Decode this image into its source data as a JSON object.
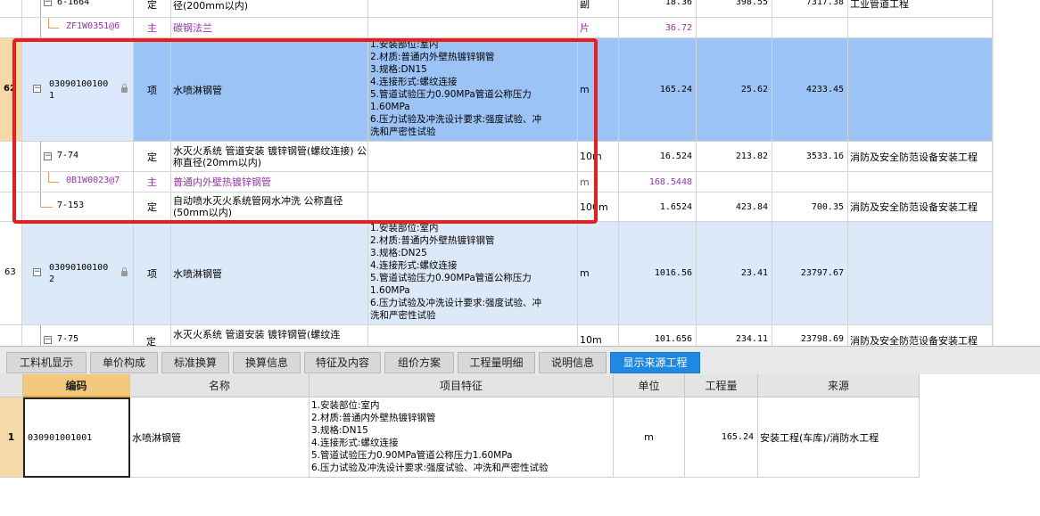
{
  "upper_grid": {
    "rows": [
      {
        "idx": "",
        "code": "6-1664",
        "type": "定",
        "name": "径(200mm以内)",
        "features": [],
        "unit": "副",
        "qty": "18.36",
        "price": "398.55",
        "total": "7317.38",
        "profession": "工业管道工程"
      },
      {
        "idx": "",
        "code": "ZF1W0351@6",
        "type": "主",
        "name": "碳钢法兰",
        "features": [],
        "unit": "片",
        "qty": "36.72",
        "price": "",
        "total": "",
        "profession": ""
      },
      {
        "idx": "62",
        "code": "030901001001",
        "type": "项",
        "name": "水喷淋钢管",
        "features": [
          "1.安装部位:室内",
          "2.材质:普通内外壁热镀锌钢管",
          "3.规格:DN15",
          "4.连接形式:螺纹连接",
          "5.管道试验压力0.90MPa管道公称压力",
          "1.60MPa",
          "6.压力试验及冲洗设计要求:强度试验、冲",
          "洗和严密性试验"
        ],
        "unit": "m",
        "qty": "165.24",
        "price": "25.62",
        "total": "4233.45",
        "profession": ""
      },
      {
        "idx": "",
        "code": "7-74",
        "type": "定",
        "name": "水灭火系统 管道安装 镀锌钢管(螺纹连接) 公称直径(20mm以内)",
        "features": [],
        "unit": "10m",
        "qty": "16.524",
        "price": "213.82",
        "total": "3533.16",
        "profession": "消防及安全防范设备安装工程"
      },
      {
        "idx": "",
        "code": "0B1W0023@7",
        "type": "主",
        "name": "普通内外壁热镀锌钢管",
        "features": [],
        "unit": "m",
        "qty": "168.5448",
        "price": "",
        "total": "",
        "profession": ""
      },
      {
        "idx": "",
        "code": "7-153",
        "type": "定",
        "name": "自动喷水灭火系统管网水冲洗 公称直径(50mm以内)",
        "features": [],
        "unit": "100m",
        "qty": "1.6524",
        "price": "423.84",
        "total": "700.35",
        "profession": "消防及安全防范设备安装工程"
      },
      {
        "idx": "63",
        "code": "030901001002",
        "type": "项",
        "name": "水喷淋钢管",
        "features": [
          "1.安装部位:室内",
          "2.材质:普通内外壁热镀锌钢管",
          "3.规格:DN25",
          "4.连接形式:螺纹连接",
          "5.管道试验压力0.90MPa管道公称压力",
          "1.60MPa",
          "6.压力试验及冲洗设计要求:强度试验、冲",
          "洗和严密性试验"
        ],
        "unit": "m",
        "qty": "1016.56",
        "price": "23.41",
        "total": "23797.67",
        "profession": ""
      },
      {
        "idx": "",
        "code": "7-75",
        "type": "定",
        "name": "水灭火系统 管道安装 镀锌钢管(螺纹连",
        "features": [],
        "unit": "10m",
        "qty": "101.656",
        "price": "234.11",
        "total": "23798.69",
        "profession": "消防及安全防范设备安装工程"
      }
    ]
  },
  "tabs": [
    {
      "label": "工料机显示",
      "active": false
    },
    {
      "label": "单价构成",
      "active": false
    },
    {
      "label": "标准换算",
      "active": false
    },
    {
      "label": "换算信息",
      "active": false
    },
    {
      "label": "特征及内容",
      "active": false
    },
    {
      "label": "组价方案",
      "active": false
    },
    {
      "label": "工程量明细",
      "active": false
    },
    {
      "label": "说明信息",
      "active": false
    },
    {
      "label": "显示来源工程",
      "active": true
    }
  ],
  "source_table": {
    "headers": [
      "编码",
      "名称",
      "项目特征",
      "单位",
      "工程量",
      "来源"
    ],
    "row": {
      "idx": "1",
      "code": "030901001001",
      "name": "水喷淋钢管",
      "features": [
        "1.安装部位:室内",
        "2.材质:普通内外壁热镀锌钢管",
        "3.规格:DN15",
        "4.连接形式:螺纹连接",
        "5.管道试验压力0.90MPa管道公称压力1.60MPa",
        "6.压力试验及冲洗设计要求:强度试验、冲洗和严密性试验"
      ],
      "unit": "m",
      "qty": "165.24",
      "source": "安装工程(车库)/消防水工程"
    }
  },
  "colors": {
    "selected_row": "#9cc3f5",
    "item_row": "#dce9f8",
    "material_text": "#9b2fb0",
    "highlight_box": "#e81e1e",
    "active_tab": "#1e89e4"
  }
}
